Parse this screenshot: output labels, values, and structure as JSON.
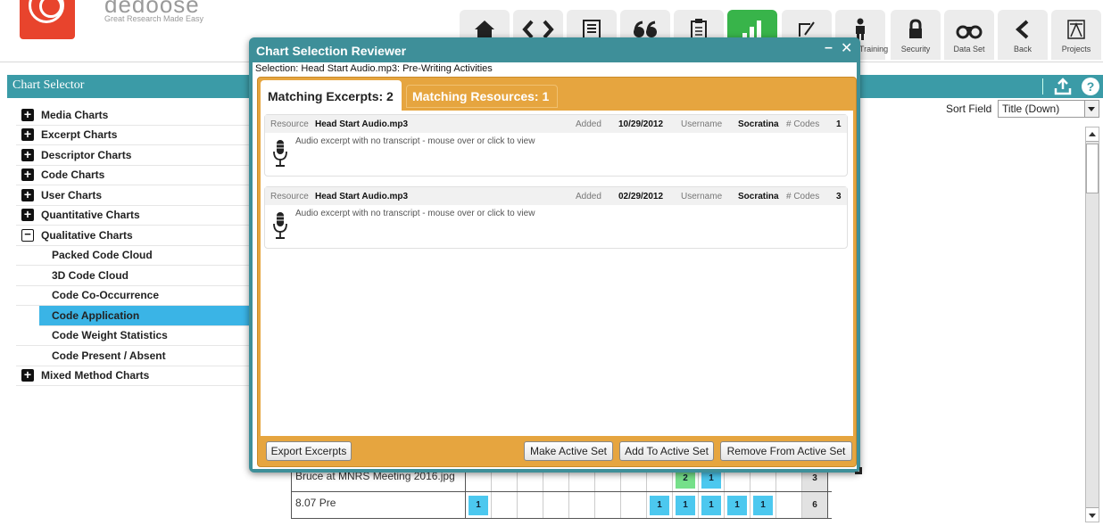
{
  "app": {
    "logo_text": "dedoose",
    "tagline": "Great Research Made Easy"
  },
  "nav": [
    {
      "name": "home",
      "icon": "home-icon",
      "label": ""
    },
    {
      "name": "code",
      "icon": "code-brackets-icon",
      "label": ""
    },
    {
      "name": "media",
      "icon": "media-icon",
      "label": ""
    },
    {
      "name": "excerpts",
      "icon": "quote-icon",
      "label": ""
    },
    {
      "name": "descriptors",
      "icon": "clipboard-icon",
      "label": ""
    },
    {
      "name": "analyze",
      "icon": "bar-chart-icon",
      "label": ""
    },
    {
      "name": "memos",
      "icon": "memo-icon",
      "label": ""
    },
    {
      "name": "training",
      "icon": "person-icon",
      "label": "Training"
    },
    {
      "name": "security",
      "icon": "lock-icon",
      "label": "Security"
    },
    {
      "name": "dataset",
      "icon": "binoculars-icon",
      "label": "Data Set"
    },
    {
      "name": "back",
      "icon": "back-arrow-icon",
      "label": "Back"
    },
    {
      "name": "projects",
      "icon": "projects-icon",
      "label": "Projects"
    }
  ],
  "sidebar": {
    "title": "Chart Selector",
    "items": [
      {
        "label": "Media Charts",
        "type": "plus"
      },
      {
        "label": "Excerpt Charts",
        "type": "plus"
      },
      {
        "label": "Descriptor Charts",
        "type": "plus"
      },
      {
        "label": "Code Charts",
        "type": "plus"
      },
      {
        "label": "User Charts",
        "type": "plus"
      },
      {
        "label": "Quantitative Charts",
        "type": "plus"
      },
      {
        "label": "Qualitative Charts",
        "type": "minus"
      },
      {
        "label": "Packed Code Cloud",
        "type": "child"
      },
      {
        "label": "3D Code Cloud",
        "type": "child"
      },
      {
        "label": "Code Co-Occurrence",
        "type": "child"
      },
      {
        "label": "Code Application",
        "type": "child-selected"
      },
      {
        "label": "Code Weight Statistics",
        "type": "child"
      },
      {
        "label": "Code Present / Absent",
        "type": "child"
      },
      {
        "label": "Mixed Method Charts",
        "type": "plus"
      }
    ]
  },
  "sort": {
    "label": "Sort Field",
    "value": "Title (Down)"
  },
  "background_table": {
    "rows": [
      {
        "name": "Bruce at MNRS Meeting 2016.jpg",
        "cells": [
          {
            "v": "",
            "c": ""
          },
          {
            "v": "",
            "c": ""
          },
          {
            "v": "",
            "c": ""
          },
          {
            "v": "",
            "c": ""
          },
          {
            "v": "",
            "c": ""
          },
          {
            "v": "",
            "c": ""
          },
          {
            "v": "",
            "c": ""
          },
          {
            "v": "",
            "c": ""
          },
          {
            "v": "2",
            "c": "green"
          },
          {
            "v": "1",
            "c": "blue"
          },
          {
            "v": "",
            "c": ""
          },
          {
            "v": "",
            "c": ""
          },
          {
            "v": "",
            "c": ""
          }
        ],
        "total": "3"
      },
      {
        "name": "8.07 Pre",
        "cells": [
          {
            "v": "1",
            "c": "blue"
          },
          {
            "v": "",
            "c": ""
          },
          {
            "v": "",
            "c": ""
          },
          {
            "v": "",
            "c": ""
          },
          {
            "v": "",
            "c": ""
          },
          {
            "v": "",
            "c": ""
          },
          {
            "v": "",
            "c": ""
          },
          {
            "v": "1",
            "c": "blue"
          },
          {
            "v": "1",
            "c": "blue"
          },
          {
            "v": "1",
            "c": "blue"
          },
          {
            "v": "1",
            "c": "blue"
          },
          {
            "v": "1",
            "c": "blue"
          },
          {
            "v": "",
            "c": ""
          }
        ],
        "total": "6"
      }
    ]
  },
  "modal": {
    "title": "Chart Selection Reviewer",
    "minimize": "–",
    "close": "✕",
    "selection": "Selection: Head Start Audio.mp3: Pre-Writing Activities",
    "tabs": {
      "excerpts": "Matching Excerpts: 2",
      "resources": "Matching Resources: 1"
    },
    "excerpts": [
      {
        "resource_label": "Resource",
        "resource": "Head Start Audio.mp3",
        "added_label": "Added",
        "added": "10/29/2012",
        "username_label": "Username",
        "username": "Socratina",
        "codes_label": "# Codes",
        "codes": "1",
        "note": "Audio excerpt with no transcript - mouse over or click to view"
      },
      {
        "resource_label": "Resource",
        "resource": "Head Start Audio.mp3",
        "added_label": "Added",
        "added": "02/29/2012",
        "username_label": "Username",
        "username": "Socratina",
        "codes_label": "# Codes",
        "codes": "3",
        "note": "Audio excerpt with no transcript - mouse over or click to view"
      }
    ],
    "buttons": {
      "export": "Export Excerpts",
      "make_active": "Make Active Set",
      "add_active": "Add To Active Set",
      "remove_active": "Remove From Active Set"
    }
  },
  "colors": {
    "teal": "#3b9ba7",
    "nav_active": "#38b44a",
    "selected_row": "#3ab4e6",
    "modal_tab_frame": "#e6a53f",
    "logo": "#e8442d"
  }
}
